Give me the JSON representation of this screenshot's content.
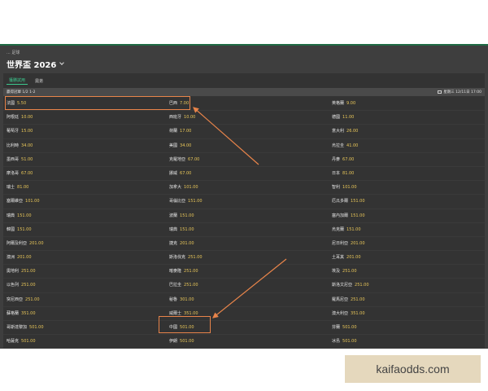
{
  "breadcrumb": "... 足球",
  "title": "世界盃 2026",
  "tabs": [
    "獲勝試用",
    "奧弟"
  ],
  "sub_header": {
    "left": "贏得冠軍 1/2 1-2",
    "right": "星期三 12/11日 17:00"
  },
  "teams": [
    [
      "法國",
      "5.50",
      "巴西",
      "7.00",
      "英格蘭",
      "9.00"
    ],
    [
      "阿根廷",
      "10.00",
      "西班牙",
      "10.00",
      "德國",
      "11.00"
    ],
    [
      "葡萄牙",
      "15.00",
      "荷蘭",
      "17.00",
      "意大利",
      "26.00"
    ],
    [
      "比利時",
      "34.00",
      "美國",
      "34.00",
      "烏拉圭",
      "41.00"
    ],
    [
      "墨西哥",
      "51.00",
      "克羅地亞",
      "67.00",
      "丹麥",
      "67.00"
    ],
    [
      "摩洛哥",
      "67.00",
      "挪威",
      "67.00",
      "日本",
      "81.00"
    ],
    [
      "瑞士",
      "81.00",
      "加拿大",
      "101.00",
      "智利",
      "101.00"
    ],
    [
      "塞爾維亞",
      "101.00",
      "哥倫比亞",
      "151.00",
      "厄瓜多爾",
      "151.00"
    ],
    [
      "瑞典",
      "151.00",
      "波蘭",
      "151.00",
      "塞內加爾",
      "151.00"
    ],
    [
      "韓國",
      "151.00",
      "瑞典",
      "151.00",
      "烏克蘭",
      "151.00"
    ],
    [
      "阿爾及利亞",
      "201.00",
      "捷克",
      "201.00",
      "尼日利亞",
      "201.00"
    ],
    [
      "澳洲",
      "201.00",
      "斯洛伐克",
      "251.00",
      "土耳其",
      "201.00"
    ],
    [
      "奧地利",
      "251.00",
      "喀麥隆",
      "251.00",
      "埃及",
      "251.00"
    ],
    [
      "以色列",
      "251.00",
      "巴拉圭",
      "251.00",
      "斯洛文尼亞",
      "251.00"
    ],
    [
      "突尼西亞",
      "251.00",
      "秘魯",
      "301.00",
      "羅馬尼亞",
      "251.00"
    ],
    [
      "蘇格蘭",
      "351.00",
      "威爾士",
      "351.00",
      "澳大利亞",
      "351.00"
    ],
    [
      "哥斯達黎加",
      "501.00",
      "中國",
      "501.00",
      "芬蘭",
      "501.00"
    ],
    [
      "哈薩克",
      "501.00",
      "伊朗",
      "501.00",
      "冰島",
      "501.00"
    ]
  ],
  "colors": {
    "header_green": "#1f6b45",
    "accent_green": "#3cc98f",
    "odds_yellow": "#e8c659",
    "annotation_orange": "#e8844a"
  },
  "watermark": "kaifaodds.com"
}
